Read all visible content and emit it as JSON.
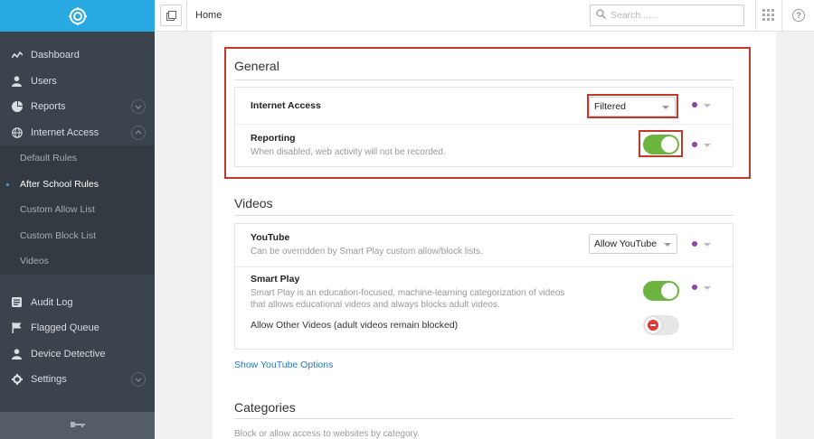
{
  "colors": {
    "brand": "#29a9e1",
    "sidebar": "#3b434c",
    "toggle_on": "#6cb33f",
    "highlight": "#c0392b",
    "link": "#2a7ab8",
    "status_dot": "#8e44ad"
  },
  "sidebar": {
    "logo_icon": "target-logo-icon",
    "items": [
      {
        "label": "Dashboard",
        "icon": "activity-icon"
      },
      {
        "label": "Users",
        "icon": "user-icon"
      },
      {
        "label": "Reports",
        "icon": "pie-chart-icon"
      },
      {
        "label": "Internet Access",
        "icon": "globe-icon"
      }
    ],
    "subitems": [
      {
        "label": "Default Rules"
      },
      {
        "label": "After School Rules"
      },
      {
        "label": "Custom Allow List"
      },
      {
        "label": "Custom Block List"
      },
      {
        "label": "Videos"
      }
    ],
    "items2": [
      {
        "label": "Audit Log",
        "icon": "list-icon"
      },
      {
        "label": "Flagged Queue",
        "icon": "flag-icon"
      },
      {
        "label": "Device Detective",
        "icon": "user-icon"
      },
      {
        "label": "Settings",
        "icon": "gear-icon"
      }
    ],
    "footer_icon": "collapse-key-icon"
  },
  "topbar": {
    "home": "Home",
    "search_placeholder": "Search......"
  },
  "general": {
    "title": "General",
    "internet_access": {
      "title": "Internet Access",
      "value": "Filtered"
    },
    "reporting": {
      "title": "Reporting",
      "desc": "When disabled, web activity will not be recorded.",
      "state": "on"
    }
  },
  "videos": {
    "title": "Videos",
    "youtube": {
      "title": "YouTube",
      "desc": "Can be overridden by Smart Play custom allow/block lists.",
      "value": "Allow YouTube"
    },
    "smart_play": {
      "title": "Smart Play",
      "desc": "Smart Play is an education-focused, machine-learning categorization of videos that allows educational videos and always blocks adult videos.",
      "state": "on"
    },
    "allow_other": {
      "label": "Allow Other Videos (adult videos remain blocked)",
      "state": "off"
    },
    "show_options": "Show YouTube Options"
  },
  "categories": {
    "title": "Categories",
    "desc": "Block or allow access to websites by category."
  }
}
